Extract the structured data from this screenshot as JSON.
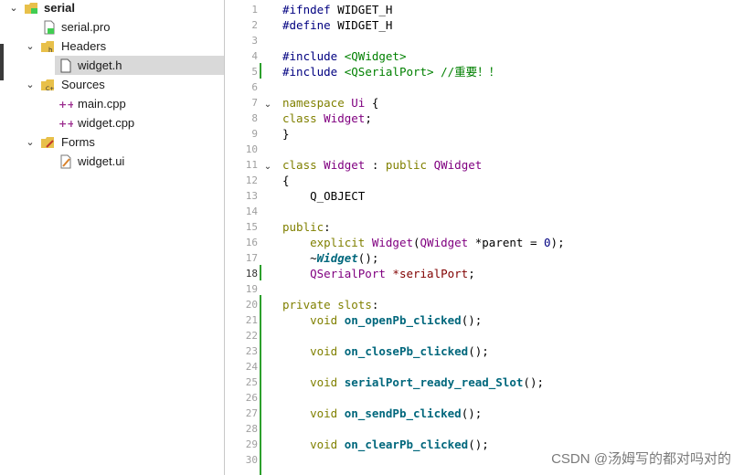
{
  "project_tree": {
    "root": "serial",
    "pro_file": "serial.pro",
    "headers_label": "Headers",
    "header_file": "widget.h",
    "sources_label": "Sources",
    "source_main": "main.cpp",
    "source_widget": "widget.cpp",
    "forms_label": "Forms",
    "form_file": "widget.ui"
  },
  "editor": {
    "line_numbers": [
      "1",
      "2",
      "3",
      "4",
      "5",
      "6",
      "7",
      "8",
      "9",
      "10",
      "11",
      "12",
      "13",
      "14",
      "15",
      "16",
      "17",
      "18",
      "19",
      "20",
      "21",
      "22",
      "23",
      "24",
      "25",
      "26",
      "27",
      "28",
      "29",
      "30"
    ],
    "current_line": "18"
  },
  "code": {
    "l1a": "#ifndef",
    "l1b": " WIDGET_H",
    "l2a": "#define",
    "l2b": " WIDGET_H",
    "l4a": "#include",
    "l4b": " <QWidget>",
    "l5a": "#include",
    "l5b": " <QSerialPort>",
    "l5c": " //重要！！",
    "l7a": "namespace",
    "l7b": " Ui",
    "l7c": " {",
    "l8a": "class",
    "l8b": " Widget",
    "l8c": ";",
    "l9": "}",
    "l11a": "class",
    "l11b": " Widget",
    "l11c": " :",
    "l11d": " public",
    "l11e": " QWidget",
    "l12": "{",
    "l13": "    Q_OBJECT",
    "l15a": "public",
    "l15b": ":",
    "l16a": "    explicit",
    "l16b": " Widget",
    "l16c": "(",
    "l16d": "QWidget",
    "l16e": " *parent = ",
    "l16f": "0",
    "l16g": ");",
    "l17a": "    ~",
    "l17b": "Widget",
    "l17c": "();",
    "l18a": "    QSerialPort",
    "l18b": " *serialPort",
    "l18c": ";",
    "l20a": "private",
    "l20b": " slots",
    "l20c": ":",
    "l21a": "    void",
    "l21b": " on_openPb_clicked",
    "l21c": "();",
    "l23a": "    void",
    "l23b": " on_closePb_clicked",
    "l23c": "();",
    "l25a": "    void",
    "l25b": " serialPort_ready_read_Slot",
    "l25c": "();",
    "l27a": "    void",
    "l27b": " on_sendPb_clicked",
    "l27c": "();",
    "l29a": "    void",
    "l29b": " on_clearPb_clicked",
    "l29c": "();"
  },
  "watermark": "CSDN @汤姆写的都对吗对的",
  "colors": {
    "keyword": "#808000",
    "type": "#800080",
    "include": "#008000",
    "function": "#00677c",
    "change_marker": "#2ca02c",
    "selection": "#d9d9d9"
  }
}
